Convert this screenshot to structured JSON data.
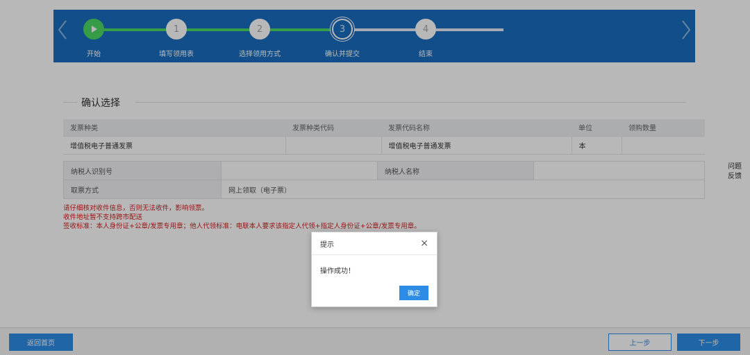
{
  "stepper": {
    "steps": [
      {
        "number": "",
        "label": "开始",
        "state": "done"
      },
      {
        "number": "1",
        "label": "填写领用表",
        "state": "done"
      },
      {
        "number": "2",
        "label": "选择领用方式",
        "state": "done"
      },
      {
        "number": "3",
        "label": "确认并提交",
        "state": "current"
      },
      {
        "number": "4",
        "label": "结束",
        "state": "todo"
      }
    ],
    "colors": {
      "bar": "#1a6ec0",
      "done": "#4cd964",
      "todo": "#e6eef8"
    }
  },
  "section": {
    "title": "确认选择"
  },
  "invoice_table": {
    "headers": [
      "发票种类",
      "发票种类代码",
      "发票代码名称",
      "单位",
      "领购数量"
    ],
    "rows": [
      [
        "增值税电子普通发票",
        "",
        "增值税电子普通发票",
        "本",
        ""
      ]
    ]
  },
  "info_table": {
    "taxpayer_id_label": "纳税人识别号",
    "taxpayer_id_value": "",
    "taxpayer_name_label": "纳税人名称",
    "taxpayer_name_value": "",
    "pickup_label": "取票方式",
    "pickup_value": "网上领取（电子票）"
  },
  "notes": [
    "请仔细核对收件信息，否则无法收件，影响领票。",
    "收件地址暂不支持跨市配送",
    "签收标准：本人身份证+公章/发票专用章；他人代领标准：电联本人要求该指定人代领+指定人身份证+公章/发票专用章。"
  ],
  "modal": {
    "title": "提示",
    "close": "×",
    "message": "操作成功！",
    "ok_label": "确定"
  },
  "footer": {
    "home_label": "返回首页",
    "prev_label": "上一步",
    "next_label": "下一步"
  },
  "feedback": {
    "line1": "问题",
    "line2": "反馈"
  }
}
